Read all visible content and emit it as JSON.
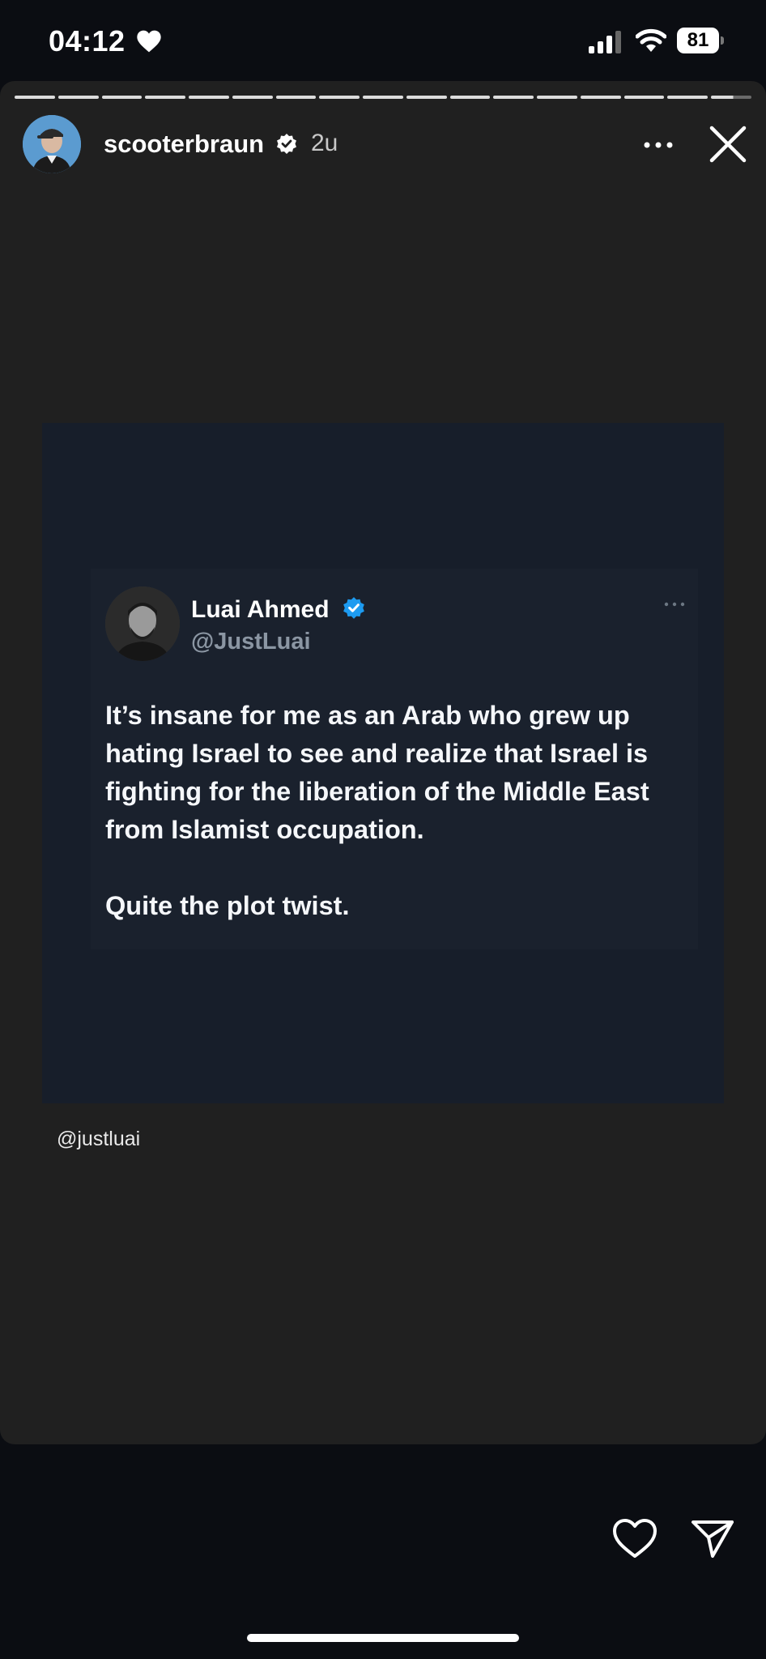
{
  "status_bar": {
    "time": "04:12",
    "battery": "81"
  },
  "story": {
    "progress_segments": 17,
    "current_segment": 17,
    "username": "scooterbraun",
    "time_ago": "2u",
    "mention": "@justluai"
  },
  "tweet": {
    "name": "Luai Ahmed",
    "handle": "@JustLuai",
    "paragraph1": "It’s insane for me as an Arab who grew up hating Israel to see and realize that Israel is fighting for the liberation of the Middle East from Islamist occupation.",
    "paragraph2": "Quite the plot twist."
  },
  "colors": {
    "verified_blue": "#1d9bf0",
    "media_bg": "#171e2a",
    "story_bg": "#202020"
  }
}
